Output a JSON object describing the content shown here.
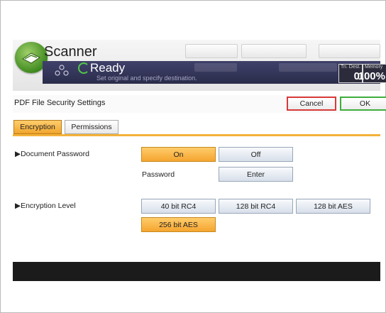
{
  "header": {
    "app_title": "Scanner",
    "status_text": "Ready",
    "status_subtext": "Set original and specify destination.",
    "counter_left_label": "Tri. Dest.",
    "counter_left_value": "0",
    "counter_right_label": "Memory",
    "counter_right_value": "100%"
  },
  "settings": {
    "title": "PDF File Security Settings",
    "cancel_label": "Cancel",
    "ok_label": "OK"
  },
  "tabs": [
    {
      "label": "Encryption",
      "active": true
    },
    {
      "label": "Permissions",
      "active": false
    }
  ],
  "document_password": {
    "section_label": "▶Document Password",
    "on_label": "On",
    "off_label": "Off",
    "selected": "On",
    "password_label": "Password",
    "enter_label": "Enter"
  },
  "encryption_level": {
    "section_label": "▶Encryption Level",
    "options": [
      "40 bit RC4",
      "128 bit RC4",
      "128 bit AES",
      "256 bit AES"
    ],
    "selected": "256 bit AES"
  },
  "colors": {
    "selected_orange": "#f5a52f",
    "tab_underline": "#f4b23a",
    "status_bar": "#2a2c4b",
    "ready_green": "#52c64a",
    "cancel_border": "#d83a3a",
    "ok_border": "#3fae3c"
  },
  "icons": {
    "app_logo": "scanner-logo-icon",
    "user": "people-icon",
    "status": "ready-circle-icon"
  }
}
